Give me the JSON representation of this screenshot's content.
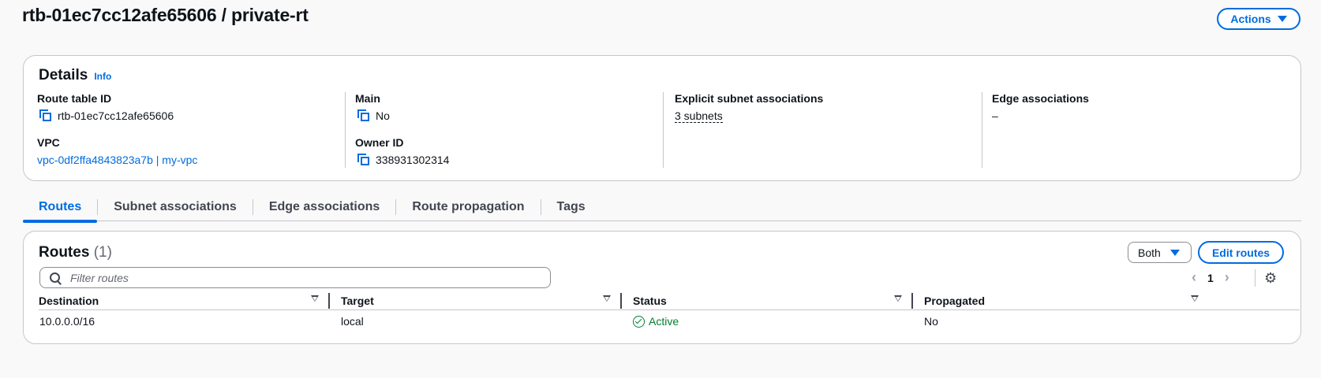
{
  "header": {
    "title": "rtb-01ec7cc12afe65606 / private-rt",
    "actions_label": "Actions"
  },
  "details": {
    "title": "Details",
    "info_label": "Info",
    "route_table_id_label": "Route table ID",
    "route_table_id": "rtb-01ec7cc12afe65606",
    "vpc_label": "VPC",
    "vpc_value": "vpc-0df2ffa4843823a7b | my-vpc",
    "main_label": "Main",
    "main_value": "No",
    "owner_id_label": "Owner ID",
    "owner_id": "338931302314",
    "explicit_subnet_label": "Explicit subnet associations",
    "explicit_subnet_value": "3 subnets",
    "edge_assoc_label": "Edge associations",
    "edge_assoc_value": "–"
  },
  "tabs": [
    {
      "label": "Routes",
      "active": true
    },
    {
      "label": "Subnet associations",
      "active": false
    },
    {
      "label": "Edge associations",
      "active": false
    },
    {
      "label": "Route propagation",
      "active": false
    },
    {
      "label": "Tags",
      "active": false
    }
  ],
  "routes": {
    "title": "Routes",
    "count": "(1)",
    "filter_select": "Both",
    "edit_label": "Edit routes",
    "filter_placeholder": "Filter routes",
    "page": "1",
    "columns": [
      "Destination",
      "Target",
      "Status",
      "Propagated"
    ],
    "rows": [
      {
        "destination": "10.0.0.0/16",
        "target": "local",
        "status": "Active",
        "propagated": "No"
      }
    ]
  },
  "icons": {
    "copy": "copy-icon",
    "search": "search-icon",
    "settings": "gear-icon",
    "status_ok": "check-circle-icon"
  },
  "colors": {
    "accent": "#006ce0",
    "success": "#00802f",
    "border": "#c6c6cd",
    "background": "#f9f9fa"
  }
}
